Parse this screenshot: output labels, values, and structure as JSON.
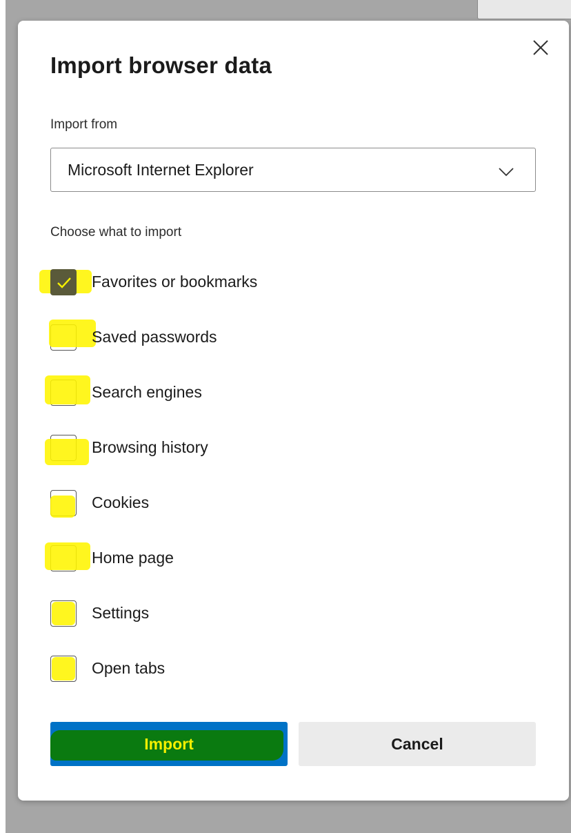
{
  "dialog": {
    "title": "Import browser data",
    "close_icon": "close-icon"
  },
  "import_from": {
    "label": "Import from",
    "selected": "Microsoft Internet Explorer",
    "icon": "chevron-down-icon"
  },
  "choose": {
    "label": "Choose what to import",
    "options": [
      {
        "label": "Favorites or bookmarks",
        "checked": true
      },
      {
        "label": "Saved passwords",
        "checked": false
      },
      {
        "label": "Search engines",
        "checked": false
      },
      {
        "label": "Browsing history",
        "checked": false
      },
      {
        "label": "Cookies",
        "checked": false
      },
      {
        "label": "Home page",
        "checked": false
      },
      {
        "label": "Settings",
        "checked": false
      },
      {
        "label": "Open tabs",
        "checked": false
      }
    ]
  },
  "buttons": {
    "import_label": "Import",
    "cancel_label": "Cancel"
  },
  "colors": {
    "primary": "#0072c6",
    "highlight": "#fff500",
    "import_mark": "#0a7a10",
    "checked_box": "#5a5a3a",
    "backdrop": "#a6a6a6"
  }
}
